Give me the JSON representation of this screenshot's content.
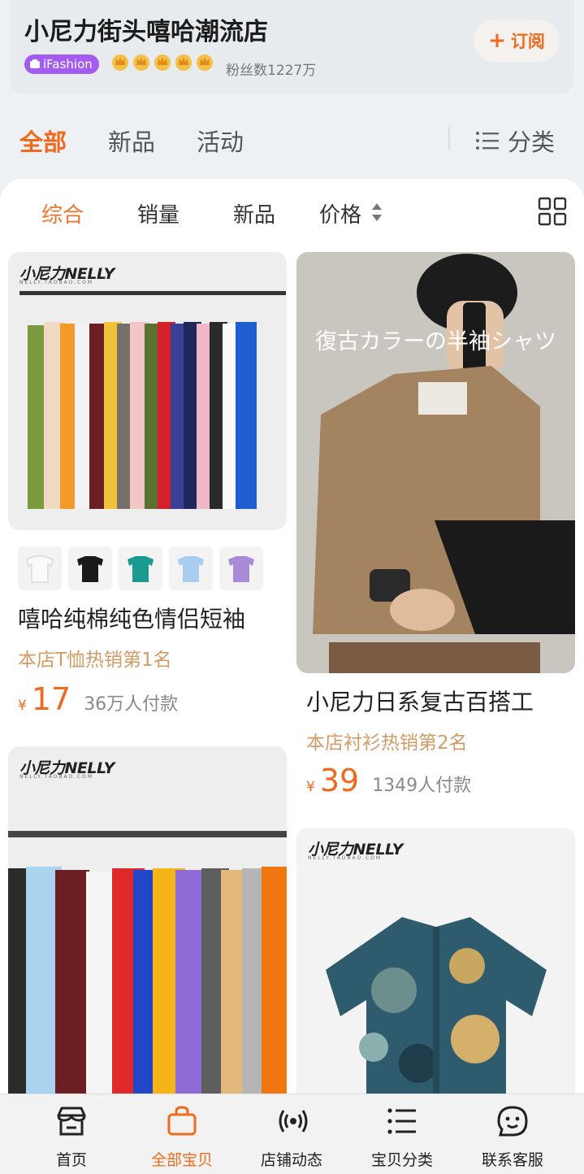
{
  "shop": {
    "name": "小尼力街头嘻哈潮流店",
    "badge": "iFashion",
    "fans": "粉丝数1227万",
    "subscribe": "订阅",
    "subscribe_icon": "plus-icon"
  },
  "top_tabs": {
    "all": "全部",
    "new": "新品",
    "activity": "活动",
    "category": "分类"
  },
  "sort_tabs": {
    "overall": "综合",
    "sales": "销量",
    "new": "新品",
    "price": "价格"
  },
  "products": [
    {
      "brand": "小尼力NELLY",
      "brand_sub": "NELLY.TAOBAO.COM",
      "title": "嘻哈纯棉纯色情侣短袖",
      "rank": "本店T恤热销第1名",
      "currency": "¥",
      "price": "17",
      "sold": "36万人付款"
    },
    {
      "overlay_text": "復古カラーの半袖シャツ",
      "title": "小尼力日系复古百搭工",
      "rank": "本店衬衫热销第2名",
      "currency": "¥",
      "price": "39",
      "sold": "1349人付款"
    },
    {
      "brand": "小尼力NELLY",
      "brand_sub": "NELLY.TAOBAO.COM"
    },
    {
      "brand": "小尼力NELLY",
      "brand_sub": "NELLY.TAOBAO.COM"
    }
  ],
  "bottom_nav": [
    {
      "label": "首页",
      "icon": "store-icon"
    },
    {
      "label": "全部宝贝",
      "icon": "bag-icon"
    },
    {
      "label": "店铺动态",
      "icon": "broadcast-icon"
    },
    {
      "label": "宝贝分类",
      "icon": "list-icon"
    },
    {
      "label": "联系客服",
      "icon": "chat-icon"
    }
  ],
  "colors": {
    "accent": "#ef6a1c",
    "rank": "#d39b66",
    "badge": "#a45cf0"
  }
}
